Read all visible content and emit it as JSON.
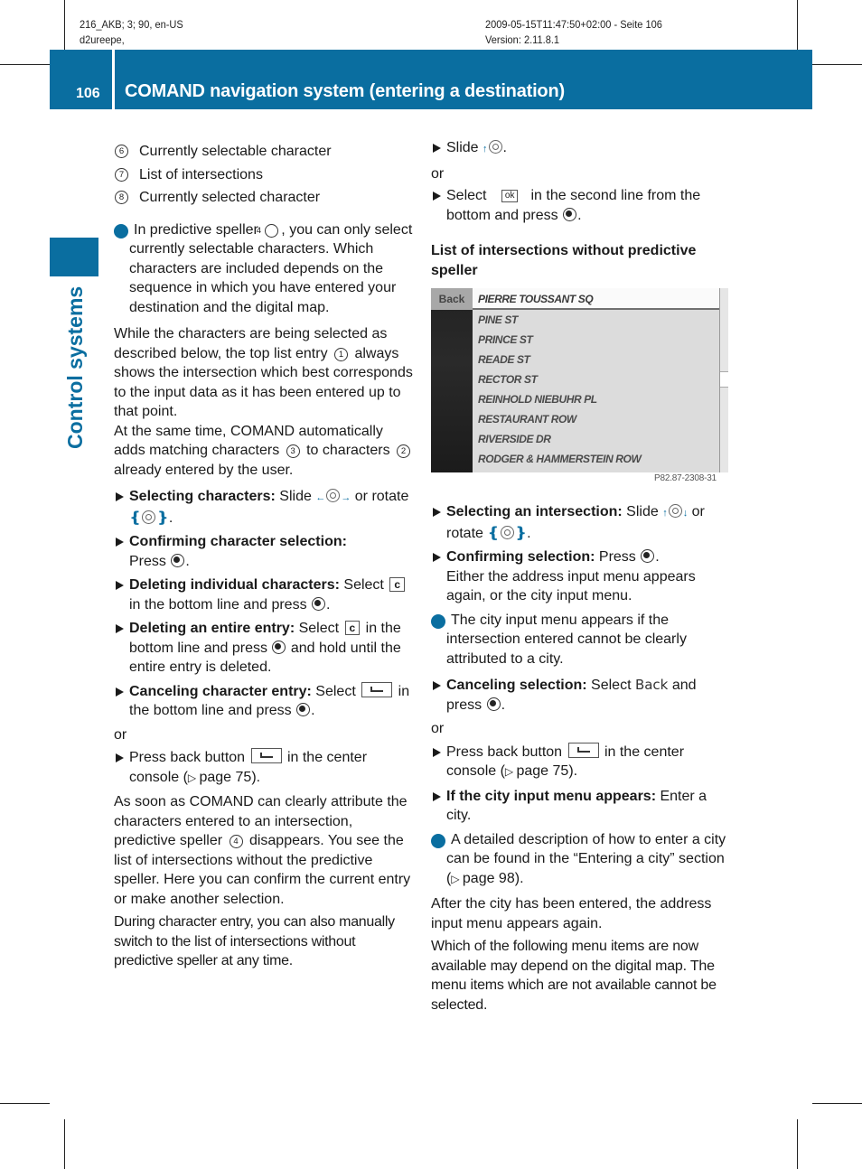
{
  "print_meta": {
    "left_line1": "216_AKB; 3; 90, en-US",
    "left_line2": "d2ureepe,",
    "right_line1": "2009-05-15T11:47:50+02:00 - Seite 106",
    "right_line2": "Version: 2.11.8.1"
  },
  "header": {
    "page_number": "106",
    "title": "COMAND navigation system (entering a destination)",
    "accent_color": "#0a6ea0"
  },
  "sidebar": {
    "section_label": "Control systems"
  },
  "left_column": {
    "legend": [
      {
        "num": "6",
        "text": "Currently selectable character"
      },
      {
        "num": "7",
        "text": "List of intersections"
      },
      {
        "num": "8",
        "text": "Currently selected character"
      }
    ],
    "info1": {
      "pre": "In predictive speller ",
      "ref": "4",
      "post": ", you can only select currently selectable characters. Which characters are included depends on the sequence in which you have entered your destination and the digital map."
    },
    "para1": {
      "a": "While the characters are being selected as described below, the top list entry ",
      "ref1": "1",
      "b": " always shows the intersection which best corresponds to the input data as it has been entered up to that point.",
      "c": "At the same time, COMAND automatically adds matching characters ",
      "ref3": "3",
      "d": " to characters ",
      "ref2": "2",
      "e": " already entered by the user."
    },
    "steps": [
      {
        "bold": "Selecting characters:",
        "pre": " Slide ",
        "mid": " or rotate ",
        "post": "."
      },
      {
        "bold": "Confirming character selection:",
        "pre": "Press ",
        "post": "."
      },
      {
        "bold": "Deleting individual characters:",
        "pre": " Select ",
        "key": "c",
        "post": " in the bottom line and press ",
        "end": "."
      },
      {
        "bold": "Deleting an entire entry:",
        "pre": " Select ",
        "key": "c",
        "post": " in the bottom line and press ",
        "end": " and hold until the entire entry is deleted."
      },
      {
        "bold": "Canceling character entry:",
        "pre": " Select ",
        "post": " in the bottom line and press ",
        "end": "."
      }
    ],
    "or1": "or",
    "back_step": {
      "pre": "Press back button ",
      "post": " in the center console (",
      "ref": "page 75",
      "end": ")."
    },
    "para2": {
      "a": "As soon as COMAND can clearly attribute the characters entered to an intersection, predictive speller ",
      "ref": "4",
      "b": " disappears. You see the list of intersections without the predictive speller. Here you can confirm the current entry or make another selection."
    },
    "para3": "During character entry, you can also manually switch to the list of intersections without predictive speller at any time."
  },
  "right_column": {
    "slide_step": {
      "pre": "Slide ",
      "post": "."
    },
    "or1": "or",
    "select_ok_step": {
      "pre": "Select ",
      "key": "ok",
      "post": "in the second line from the bottom and press ",
      "end": "."
    },
    "subheading": "List of intersections without predictive speller",
    "screen": {
      "back_label": "Back",
      "items": [
        "PIERRE TOUSSANT SQ",
        "PINE ST",
        "PRINCE ST",
        "READE ST",
        "RECTOR ST",
        "REINHOLD NIEBUHR PL",
        "RESTAURANT ROW",
        "RIVERSIDE DR",
        "RODGER & HAMMERSTEIN ROW"
      ],
      "selected_index": 0,
      "figure_code": "P82.87-2308-31"
    },
    "steps": [
      {
        "bold": "Selecting an intersection:",
        "pre": " Slide ",
        "mid": " or rotate ",
        "post": "."
      },
      {
        "bold": "Confirming selection:",
        "pre": " Press ",
        "post": ".",
        "extra": "Either the address input menu appears again, or the city input menu."
      }
    ],
    "info1": "The city input menu appears if the intersection entered cannot be clearly attributed to a city.",
    "cancel_step": {
      "bold": "Canceling selection:",
      "pre": " Select ",
      "mono": "Back",
      "post": " and press ",
      "end": "."
    },
    "or2": "or",
    "back_step": {
      "pre": "Press back button ",
      "post": " in the center console (",
      "ref": "page 75",
      "end": ")."
    },
    "city_step": {
      "bold": "If the city input menu appears:",
      "post": " Enter a city."
    },
    "info2": {
      "pre": "A detailed description of how to enter a city can be found in the “Entering a city” section (",
      "ref": "page 98",
      "end": ")."
    },
    "para1": "After the city has been entered, the address input menu appears again.",
    "para2": "Which of the following menu items are now available may depend on the digital map. The menu items which are not available cannot be selected."
  }
}
